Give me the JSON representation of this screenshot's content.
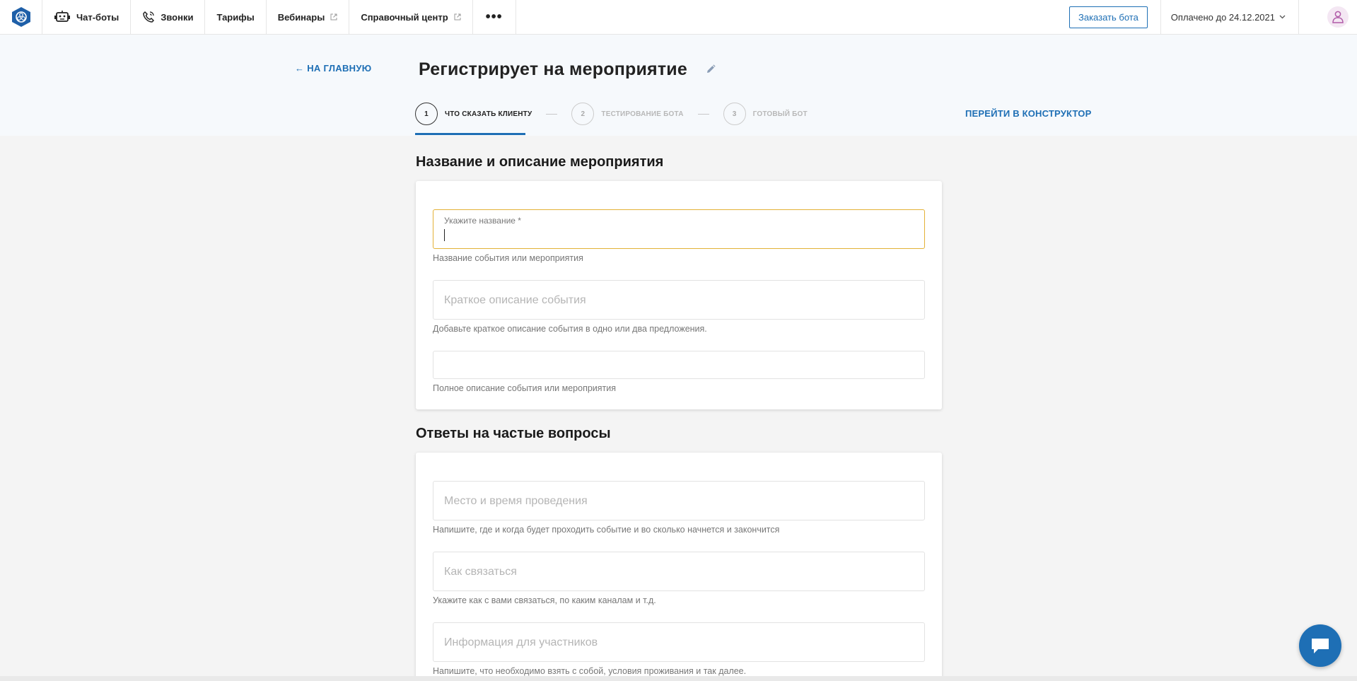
{
  "nav": {
    "items": [
      {
        "label": "Чат-боты",
        "icon": "robot-icon"
      },
      {
        "label": "Звонки",
        "icon": "phone-icon"
      },
      {
        "label": "Тарифы"
      },
      {
        "label": "Вебинары",
        "external": true
      },
      {
        "label": "Справочный центр",
        "external": true
      }
    ],
    "more_label": "•••",
    "order_button": "Заказать бота",
    "paid_until": "Оплачено до 24.12.2021"
  },
  "header": {
    "back_label": "НА ГЛАВНУЮ",
    "title": "Регистрирует на мероприятие",
    "constructor_link": "ПЕРЕЙТИ В КОНСТРУКТОР",
    "steps": [
      {
        "number": "1",
        "label": "ЧТО СКАЗАТЬ КЛИЕНТУ",
        "active": true
      },
      {
        "number": "2",
        "label": "ТЕСТИРОВАНИЕ БОТА",
        "active": false
      },
      {
        "number": "3",
        "label": "ГОТОВЫЙ БОТ",
        "active": false
      }
    ]
  },
  "section1": {
    "title": "Название и описание мероприятия",
    "fields": [
      {
        "label": "Укажите название *",
        "value": "",
        "hint": "Название события или мероприятия"
      },
      {
        "placeholder": "Краткое описание события",
        "hint": "Добавьте краткое описание события в одно или два предложения."
      },
      {
        "placeholder": "",
        "hint": "Полное описание события или мероприятия"
      }
    ]
  },
  "section2": {
    "title": "Ответы на частые вопросы",
    "fields": [
      {
        "placeholder": "Место и время проведения",
        "hint": "Напишите, где и когда будет проходить событие и во сколько начнется и закончится"
      },
      {
        "placeholder": "Как связаться",
        "hint": "Укажите как с вами связаться, по каким каналам и т.д."
      },
      {
        "placeholder": "Информация для участников",
        "hint": "Напишите, что необходимо взять с собой, условия проживания и так далее."
      }
    ]
  },
  "colors": {
    "accent": "#1e6fb5",
    "focus": "#e3b137"
  }
}
